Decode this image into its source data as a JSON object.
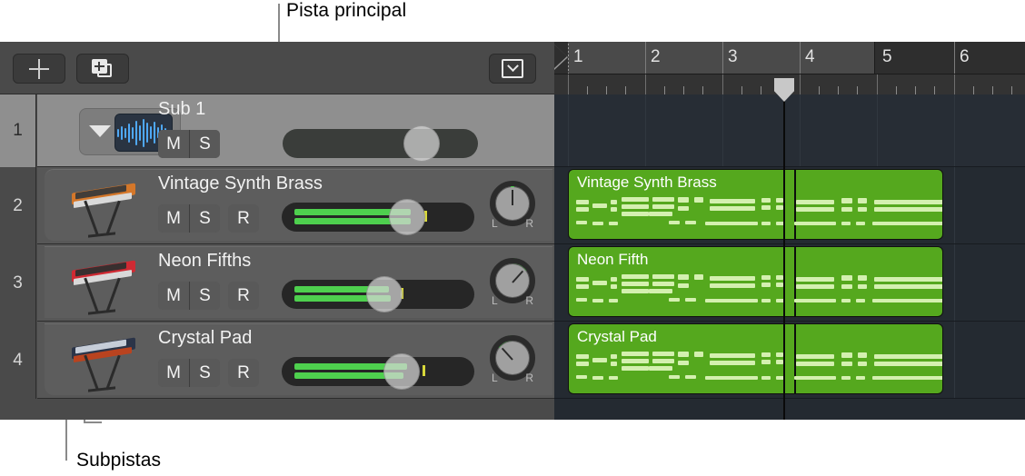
{
  "annotations": {
    "main_track_label": "Pista principal",
    "subtracks_label": "Subpistas"
  },
  "toolbar": {
    "add_track_label": "+",
    "add_track_icon": "plus-icon",
    "duplicate_track_icon": "duplicate-track-icon",
    "collapse_icon": "chevron-down-box-icon"
  },
  "ruler": {
    "bars": [
      "1",
      "2",
      "3",
      "4",
      "5",
      "6"
    ],
    "playhead_bar": "4",
    "cycle_start_bar": "1",
    "cycle_end_bar": "5"
  },
  "tracks": [
    {
      "number": "1",
      "name": "Sub 1",
      "type": "summing-stack",
      "icon": "audio-waveform-icon",
      "disclosure": "disclosure-triangle-open",
      "buttons": [
        "M",
        "S"
      ],
      "selected": true,
      "has_record": false,
      "has_pan": false,
      "fader_position_pct": 69,
      "meter_level_pct": 0
    },
    {
      "number": "2",
      "name": "Vintage Synth Brass",
      "type": "software-instrument",
      "icon": "keyboard-orange-icon",
      "buttons": [
        "M",
        "S",
        "R"
      ],
      "selected": false,
      "has_record": true,
      "has_pan": true,
      "fader_position_pct": 65,
      "meter_level_pct": 66,
      "peak_pct": 74,
      "pan_angle": 0,
      "pan_arc_start": -6,
      "pan_arc_end": 6,
      "pan_labels": {
        "left": "L",
        "right": "R"
      }
    },
    {
      "number": "3",
      "name": "Neon Fifths",
      "type": "software-instrument",
      "icon": "keyboard-red-icon",
      "buttons": [
        "M",
        "S",
        "R"
      ],
      "selected": false,
      "has_record": true,
      "has_pan": true,
      "fader_position_pct": 52,
      "meter_level_pct": 54,
      "peak_pct": 62,
      "pan_angle": 42,
      "pan_arc_start": 5,
      "pan_arc_end": 52,
      "pan_labels": {
        "left": "L",
        "right": "R"
      }
    },
    {
      "number": "4",
      "name": "Crystal Pad",
      "type": "software-instrument",
      "icon": "keyboard-dark-icon",
      "buttons": [
        "M",
        "S",
        "R"
      ],
      "selected": false,
      "has_record": true,
      "has_pan": true,
      "fader_position_pct": 62,
      "meter_level_pct": 63,
      "peak_pct": 73,
      "pan_angle": -42,
      "pan_arc_start": -52,
      "pan_arc_end": -5,
      "pan_labels": {
        "left": "L",
        "right": "R"
      }
    }
  ],
  "regions": [
    {
      "track": "2",
      "name": "Vintage Synth Brass",
      "start_bar": 1,
      "end_bar": 5.9,
      "split_bar": 4
    },
    {
      "track": "3",
      "name": "Neon Fifth",
      "start_bar": 1,
      "end_bar": 5.9,
      "split_bar": 4
    },
    {
      "track": "4",
      "name": "Crystal Pad",
      "start_bar": 1,
      "end_bar": 5.9,
      "split_bar": 4
    }
  ],
  "colors": {
    "region_green": "#55a81e",
    "note_green": "#d4f0b0",
    "meter_green": "#4ed04e",
    "peak_yellow": "#d8d83a",
    "pan_green": "#4ed04e",
    "waveform_blue": "#4fa8f5",
    "selected_row": "#8f8f8f",
    "callout_gray": "#8a8a8a"
  }
}
